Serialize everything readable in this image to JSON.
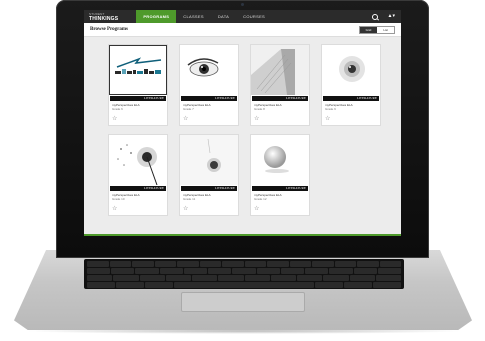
{
  "nav": {
    "logo_main": "THINKINGS",
    "logo_top": "STUDENT",
    "tabs": [
      {
        "label": "PROGRAMS",
        "active": true
      },
      {
        "label": "CLASSES",
        "active": false
      },
      {
        "label": "DATA",
        "active": false
      },
      {
        "label": "COURSES",
        "active": false
      }
    ],
    "user_icon": "▲▾"
  },
  "header": {
    "title": "Browse Programs",
    "view_options": [
      "Grid",
      "List"
    ],
    "active_view": "Grid"
  },
  "cards": [
    {
      "band": "LITERATURE",
      "title": "myPerspectives ELA",
      "sub": "Grade 6",
      "cover": "typographic-logo"
    },
    {
      "band": "LITERATURE",
      "title": "myPerspectives ELA",
      "sub": "Grade 7",
      "cover": "eye"
    },
    {
      "band": "LITERATURE",
      "title": "myPerspectives ELA",
      "sub": "Grade 8",
      "cover": "building"
    },
    {
      "band": "LITERATURE",
      "title": "myPerspectives ELA",
      "sub": "Grade 9",
      "cover": "eye-dark"
    },
    {
      "band": "LITERATURE",
      "title": "myPerspectives ELA",
      "sub": "Grade 10",
      "cover": "dandelion"
    },
    {
      "band": "LITERATURE",
      "title": "myPerspectives ELA",
      "sub": "Grade 11",
      "cover": "pin"
    },
    {
      "band": "LITERATURE",
      "title": "myPerspectives ELA",
      "sub": "Grade 12",
      "cover": "sphere"
    }
  ],
  "colors": {
    "accent": "#4e9a2b",
    "navbar": "#2b2b2b"
  }
}
